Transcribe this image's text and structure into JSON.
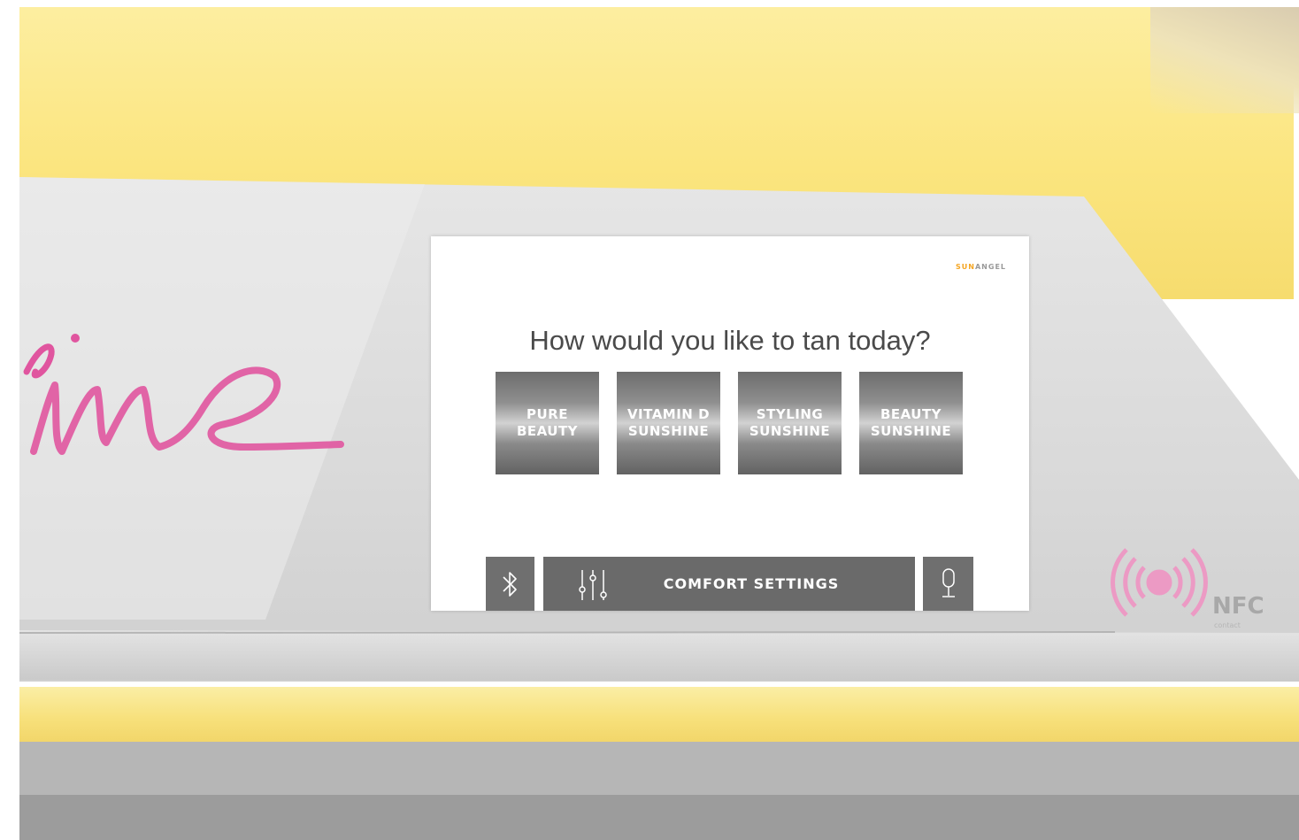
{
  "screen": {
    "brand_prefix": "SUN",
    "brand_suffix": "ANGEL",
    "question": "How would you like to tan today?",
    "modes": [
      {
        "label": "PURE\nBEAUTY"
      },
      {
        "label": "VITAMIN D\nSUNSHINE"
      },
      {
        "label": "STYLING\nSUNSHINE"
      },
      {
        "label": "BEAUTY\nSUNSHINE"
      }
    ],
    "bottom_bar": {
      "bluetooth_icon": "bluetooth-icon",
      "comfort_icon": "sliders-icon",
      "comfort_label": "COMFORT SETTINGS",
      "mic_icon": "microphone-icon"
    }
  },
  "nfc": {
    "icon": "nfc-icon",
    "label": "NFC",
    "sublabel": "contact"
  },
  "colors": {
    "housing_yellow": "#fbe57f",
    "panel_gray": "#dddddd",
    "button_gray": "#6a6a6a",
    "brand_accent": "#f5a623",
    "script_pink": "#e0559f",
    "nfc_pink": "#ec9ac4"
  }
}
